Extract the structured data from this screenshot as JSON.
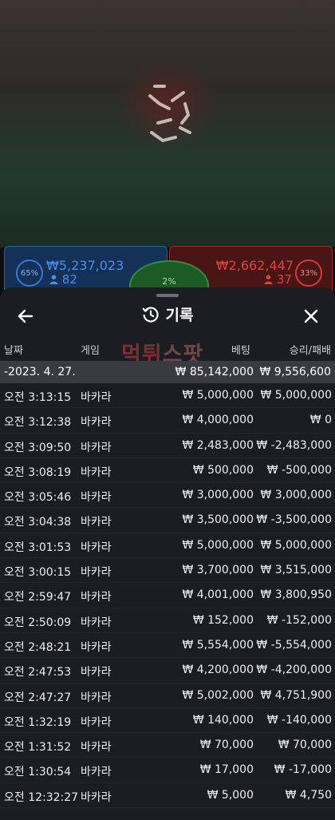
{
  "game": {
    "player_panel": {
      "ratio": "65%",
      "amount": "₩5,237,023",
      "count": "82"
    },
    "banker_panel": {
      "ratio": "33%",
      "amount": "₩2,662,447",
      "count": "37"
    },
    "tie_ratio": "2%"
  },
  "sheet": {
    "title": "기록",
    "columns": {
      "date": "날짜",
      "game": "게임",
      "bet": "베팅",
      "result": "승리/패배"
    },
    "watermark": {
      "part1": "먹튀",
      "part2": "스팟"
    },
    "summary": {
      "date": "-2023. 4. 27.",
      "bet": "₩ 85,142,000",
      "result": "₩ 9,556,600"
    },
    "rows": [
      {
        "time": "오전 3:13:15",
        "game": "바카라",
        "bet": "₩ 5,000,000",
        "result": "₩ 5,000,000"
      },
      {
        "time": "오전 3:12:38",
        "game": "바카라",
        "bet": "₩ 4,000,000",
        "result": "₩ 0"
      },
      {
        "time": "오전 3:09:50",
        "game": "바카라",
        "bet": "₩ 2,483,000",
        "result": "₩ -2,483,000"
      },
      {
        "time": "오전 3:08:19",
        "game": "바카라",
        "bet": "₩ 500,000",
        "result": "₩ -500,000"
      },
      {
        "time": "오전 3:05:46",
        "game": "바카라",
        "bet": "₩ 3,000,000",
        "result": "₩ 3,000,000"
      },
      {
        "time": "오전 3:04:38",
        "game": "바카라",
        "bet": "₩ 3,500,000",
        "result": "₩ -3,500,000"
      },
      {
        "time": "오전 3:01:53",
        "game": "바카라",
        "bet": "₩ 5,000,000",
        "result": "₩ 5,000,000"
      },
      {
        "time": "오전 3:00:15",
        "game": "바카라",
        "bet": "₩ 3,700,000",
        "result": "₩ 3,515,000"
      },
      {
        "time": "오전 2:59:47",
        "game": "바카라",
        "bet": "₩ 4,001,000",
        "result": "₩ 3,800,950"
      },
      {
        "time": "오전 2:50:09",
        "game": "바카라",
        "bet": "₩ 152,000",
        "result": "₩ -152,000"
      },
      {
        "time": "오전 2:48:21",
        "game": "바카라",
        "bet": "₩ 5,554,000",
        "result": "₩ -5,554,000"
      },
      {
        "time": "오전 2:47:53",
        "game": "바카라",
        "bet": "₩ 4,200,000",
        "result": "₩ -4,200,000"
      },
      {
        "time": "오전 2:47:27",
        "game": "바카라",
        "bet": "₩ 5,002,000",
        "result": "₩ 4,751,900"
      },
      {
        "time": "오전 1:32:19",
        "game": "바카라",
        "bet": "₩ 140,000",
        "result": "₩ -140,000"
      },
      {
        "time": "오전 1:31:52",
        "game": "바카라",
        "bet": "₩ 70,000",
        "result": "₩ 70,000"
      },
      {
        "time": "오전 1:30:54",
        "game": "바카라",
        "bet": "₩ 17,000",
        "result": "₩ -17,000"
      },
      {
        "time": "오전 12:32:27",
        "game": "바카라",
        "bet": "₩ 5,000",
        "result": "₩ 4,750"
      }
    ]
  },
  "icons": {
    "back": "arrow-left-icon",
    "history": "history-clock-icon",
    "close": "close-icon",
    "loader": "loading-spinner-icon",
    "person": "person-icon"
  },
  "colors": {
    "sheet_bg": "#1c1d22",
    "summary_bg": "#3a3b40",
    "player_blue": "#4d8fe6",
    "banker_red": "#d84545",
    "tie_green": "#2f8f3c"
  }
}
